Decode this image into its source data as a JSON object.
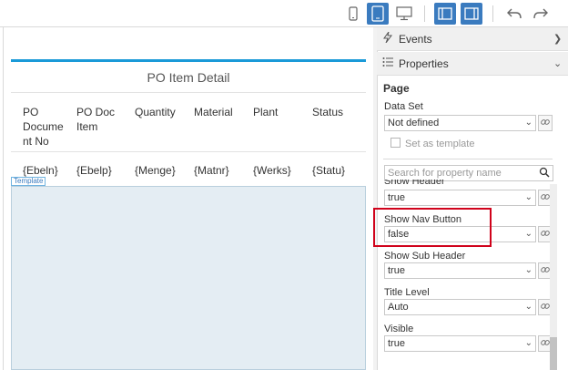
{
  "toolbar": {
    "buttons": [
      {
        "icon": "phone-icon",
        "active": false
      },
      {
        "icon": "tablet-icon",
        "active": true
      },
      {
        "icon": "desktop-icon",
        "active": false
      },
      {
        "icon": "panel-left-icon",
        "active": true
      },
      {
        "icon": "panel-right-icon",
        "active": true
      },
      {
        "icon": "undo-icon",
        "active": false
      },
      {
        "icon": "redo-icon",
        "active": false
      }
    ]
  },
  "canvas": {
    "page_title": "PO Item Detail",
    "columns": [
      {
        "header_lines": [
          "PO",
          "Docume",
          "nt No"
        ],
        "cell": "{Ebeln}"
      },
      {
        "header_lines": [
          "PO Doc",
          "Item"
        ],
        "cell": "{Ebelp}"
      },
      {
        "header_lines": [
          "Quantity"
        ],
        "cell": "{Menge}"
      },
      {
        "header_lines": [
          "Material"
        ],
        "cell": "{Matnr}"
      },
      {
        "header_lines": [
          "Plant"
        ],
        "cell": "{Werks}"
      },
      {
        "header_lines": [
          "Status"
        ],
        "cell": "{Statu}"
      }
    ],
    "template_tag": "Template"
  },
  "panel": {
    "events_label": "Events",
    "properties_label": "Properties",
    "section_title": "Page",
    "data_set": {
      "label": "Data Set",
      "value": "Not defined"
    },
    "set_as_template": {
      "label": "Set as template",
      "checked": false
    },
    "search": {
      "placeholder": "Search for property name"
    },
    "properties": [
      {
        "label": "Show Header",
        "value": "true"
      },
      {
        "label": "Show Nav Button",
        "value": "false"
      },
      {
        "label": "Show Sub Header",
        "value": "true"
      },
      {
        "label": "Title Level",
        "value": "Auto"
      },
      {
        "label": "Visible",
        "value": "true"
      }
    ]
  },
  "colors": {
    "accent": "#3a7bbf",
    "page_border": "#1a9ad8",
    "highlight": "#d0021b",
    "placeholder_fill": "#e4edf3"
  }
}
